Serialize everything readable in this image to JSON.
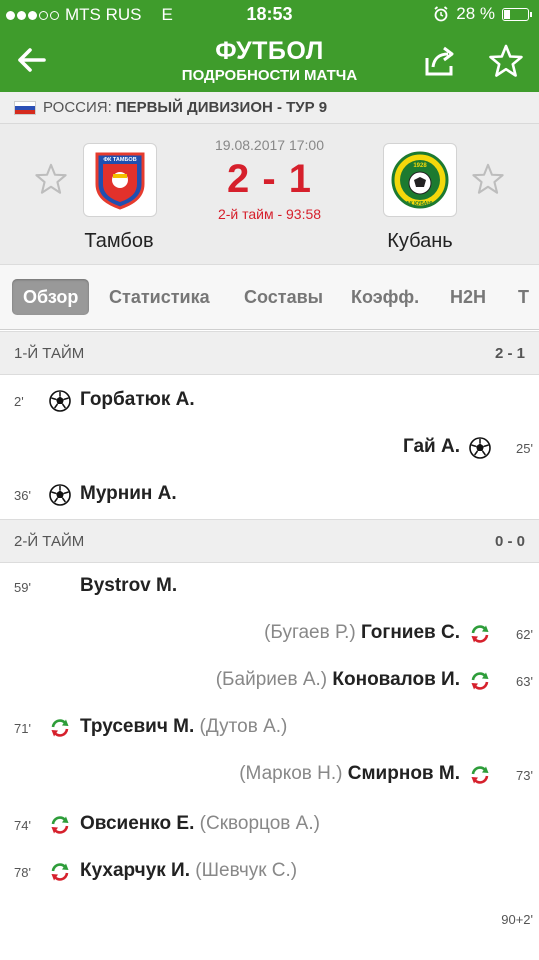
{
  "status_bar": {
    "carrier": "MTS RUS",
    "network": "E",
    "time": "18:53",
    "battery": "28 %",
    "battery_level": 0.28
  },
  "header": {
    "title": "ФУТБОЛ",
    "subtitle": "ПОДРОБНОСТИ МАТЧА"
  },
  "league": {
    "country": "РОССИЯ:",
    "name": "ПЕРВЫЙ ДИВИЗИОН - ТУР 9"
  },
  "match": {
    "datetime": "19.08.2017 17:00",
    "score": "2 - 1",
    "period": "2-й тайм - 93:58",
    "home": {
      "name": "Тамбов",
      "logo_text": "ФК ТАМБОВ"
    },
    "away": {
      "name": "Кубань",
      "logo_text": "ФК КУБАНЬ",
      "logo_year": "1928"
    }
  },
  "tabs": [
    "Обзор",
    "Статистика",
    "Составы",
    "Коэфф.",
    "H2H",
    "Т"
  ],
  "sections": [
    {
      "label": "1-Й ТАЙМ",
      "score": "2 - 1"
    },
    {
      "label": "2-Й ТАЙМ",
      "score": "0 - 0"
    }
  ],
  "events": [
    {
      "minute": "2'",
      "player": "Горбатюк А.",
      "sub": "",
      "side": "home",
      "type": "goal"
    },
    {
      "minute": "25'",
      "player": "Гай А.",
      "sub": "",
      "side": "away",
      "type": "goal"
    },
    {
      "minute": "36'",
      "player": "Мурнин А.",
      "sub": "",
      "side": "home",
      "type": "goal"
    },
    {
      "minute": "59'",
      "player": "Bystrov M.",
      "sub": "",
      "side": "home",
      "type": "yellow-card"
    },
    {
      "minute": "62'",
      "player": "Гогниев С.",
      "sub": "(Бугаев Р.)",
      "side": "away",
      "type": "substitution"
    },
    {
      "minute": "63'",
      "player": "Коновалов И.",
      "sub": "(Байриев А.)",
      "side": "away",
      "type": "substitution"
    },
    {
      "minute": "71'",
      "player": "Трусевич М.",
      "sub": "(Дутов А.)",
      "side": "home",
      "type": "substitution"
    },
    {
      "minute": "73'",
      "player": "Смирнов М.",
      "sub": "(Марков Н.)",
      "side": "away",
      "type": "substitution"
    },
    {
      "minute": "74'",
      "player": "Овсиенко Е.",
      "sub": "(Скворцов А.)",
      "side": "home",
      "type": "substitution"
    },
    {
      "minute": "78'",
      "player": "Кухарчук И.",
      "sub": "(Шевчук С.)",
      "side": "home",
      "type": "substitution"
    },
    {
      "minute": "90+2'",
      "player": "",
      "sub": "",
      "side": "away",
      "type": "yellow-card"
    }
  ],
  "colors": {
    "brand_green": "#3f9c2c",
    "score_red": "#d6202c",
    "yellow_card": "#e9b80d",
    "sub_green": "#2e9d3a",
    "sub_red": "#d6202c"
  }
}
